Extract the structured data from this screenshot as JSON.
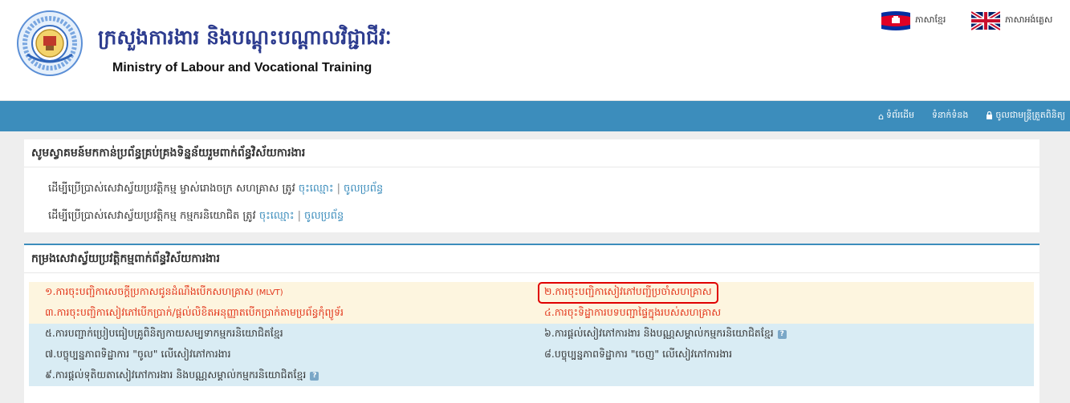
{
  "header": {
    "title_kh": "ក្រសួងការងារ និងបណ្តុះបណ្តាលវិជ្ជាជីវៈ",
    "title_en": "Ministry of Labour and Vocational Training",
    "logo_icon": "ministry-emblem"
  },
  "languages": [
    {
      "label": "ភាសាខ្មែរ",
      "icon": "cambodia-flag-icon"
    },
    {
      "label": "ភាសាអង់គ្លេស",
      "icon": "uk-flag-icon"
    }
  ],
  "nav": {
    "home_label": "ទំព័រដើម",
    "contact_label": "ទំនាក់ទំនង",
    "login_label": "ចូលជាមន្ត្រីត្រួតពិនិត្យ",
    "home_icon": "home-icon",
    "login_icon": "lock-icon"
  },
  "welcome_panel": {
    "title": "សូមស្វាគមន៍មកកាន់ប្រព័ន្ធគ្រប់គ្រងទិន្នន័យរួមពាក់ព័ន្ធវិស័យការងារ",
    "lines": [
      {
        "text": "ដើម្បីប្រើប្រាស់សេវាស្វ័យប្រវត្តិកម្ម ម្ចាស់រោងចក្រ សហគ្រាស ត្រូវ",
        "register": "ចុះឈ្មោះ",
        "separator": "|",
        "login": "ចូលប្រព័ន្ធ"
      },
      {
        "text": "ដើម្បីប្រើប្រាស់សេវាស្វ័យប្រវត្តិកម្ម កម្មករនិយោជិត ត្រូវ",
        "register": "ចុះឈ្មោះ",
        "separator": "|",
        "login": "ចូលប្រព័ន្ធ"
      }
    ]
  },
  "services_panel": {
    "title": "កម្រងសេវាស្វ័យប្រវត្តិកម្មពាក់ព័ន្ធវិស័យការងារ",
    "rows": [
      {
        "left": {
          "text": "១.ការចុះបញ្ជិកាសេចក្តីប្រកាសជូនដំណឹងបើកសហគ្រាស",
          "suffix": "(MLVT)"
        },
        "right": {
          "text": "២.ការចុះបញ្ជិកាសៀវភៅបញ្ជីប្រចាំសហគ្រាស"
        }
      },
      {
        "left": {
          "text": "៣.ការចុះបញ្ជិកាសៀវភៅបើកប្រាក់/ផ្តល់លិខិតអនុញ្ញាតបើកប្រាក់តាមប្រព័ន្ធកុំព្យូទ័រ"
        },
        "right": {
          "text": "៤.ការចុះទិដ្ឋាការបទបញ្ជាផ្ទៃក្នុងរបស់សហគ្រាស"
        }
      },
      {
        "left": {
          "text": "៥.ការបញ្ជាក់ប្រៀបធៀបគ្រូពិនិត្យកាយសម្បទាកម្មករនិយោជិតខ្មែរ"
        },
        "right": {
          "text": "៦.ការផ្តល់សៀវភៅការងារ និងបណ្ណសម្គាល់កម្មករនិយោជិតខ្មែរ",
          "help": "?"
        }
      },
      {
        "left": {
          "text": "៧.បច្ចុប្បន្នភាពទិដ្ឋាការ \"ចូល\" លើសៀវភៅការងារ"
        },
        "right": {
          "text": "៨.បច្ចុប្បន្នភាពទិដ្ឋាការ \"ចេញ\" លើសៀវភៅការងារ"
        }
      },
      {
        "left": {
          "text": "៩.ការផ្តល់ទុតិយតាសៀវភៅការងារ និងបណ្ណសម្គាល់កម្មករនិយោជិតខ្មែរ",
          "help": "?"
        },
        "right": {
          "text": ""
        }
      }
    ]
  },
  "colors": {
    "navbar": "#3c8dbc",
    "link": "#3c8dbc",
    "service_orange_bg": "#fdf5df",
    "service_orange_text": "#e23419",
    "service_blue_bg": "#d9ecf4",
    "highlight_border": "#e00000",
    "title_blue": "#2d3c8f"
  }
}
